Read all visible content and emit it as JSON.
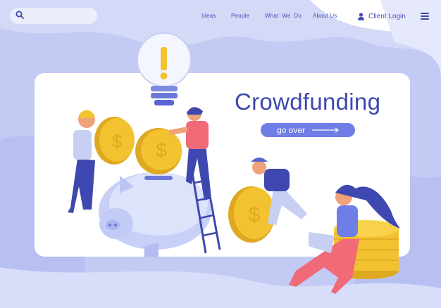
{
  "header": {
    "search": {
      "value": "",
      "placeholder": ""
    },
    "nav": [
      {
        "label": "Ideas"
      },
      {
        "label": "People"
      },
      {
        "label": "What  We  Do"
      },
      {
        "label": "About Us"
      }
    ],
    "login_label": "Client Login"
  },
  "hero": {
    "title": "Crowdfunding",
    "cta_label": "go over"
  },
  "colors": {
    "brand": "#3f47b0",
    "accent": "#6f7ee6",
    "background_blob": "#c9d0f5",
    "coin": "#f2c230"
  },
  "icons": [
    "search-icon",
    "user-icon",
    "menu-icon",
    "arrow-right-icon"
  ]
}
